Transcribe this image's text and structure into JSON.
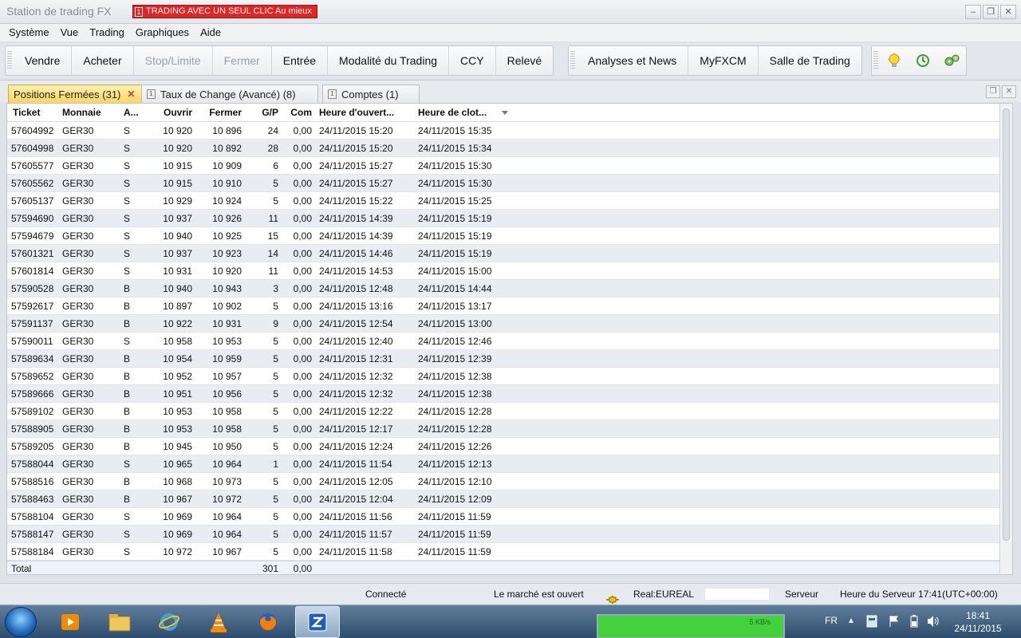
{
  "window": {
    "title": "Station de trading FX",
    "promo_badge": "1",
    "promo_text": "TRADING AVEC UN SEUL CLIC Au mieux"
  },
  "menu": [
    "Système",
    "Vue",
    "Trading",
    "Graphiques",
    "Aide"
  ],
  "toolbar": {
    "group1": [
      {
        "label": "Vendre",
        "enabled": true
      },
      {
        "label": "Acheter",
        "enabled": true
      },
      {
        "label": "Stop/Limite",
        "enabled": false
      },
      {
        "label": "Fermer",
        "enabled": false
      },
      {
        "label": "Entrée",
        "enabled": true
      },
      {
        "label": "Modalité du Trading",
        "enabled": true
      },
      {
        "label": "CCY",
        "enabled": true
      },
      {
        "label": "Relevé",
        "enabled": true
      }
    ],
    "group2": [
      {
        "label": "Analyses et News",
        "enabled": true
      },
      {
        "label": "MyFXCM",
        "enabled": true
      },
      {
        "label": "Salle de Trading",
        "enabled": true
      }
    ],
    "icons": [
      "lightbulb-icon",
      "clock-refresh-icon",
      "gears-icon"
    ]
  },
  "tabs": [
    {
      "label": "Positions Fermées (31)",
      "active": true
    },
    {
      "label": "Taux de Change (Avancé) (8)",
      "active": false,
      "icon_text": "1"
    },
    {
      "label": "Comptes (1)",
      "active": false,
      "icon_text": "1"
    }
  ],
  "table": {
    "columns": [
      "Ticket",
      "Monnaie",
      "A...",
      "Ouvrir",
      "Fermer",
      "G/P",
      "Com",
      "Heure d'ouvert...",
      "Heure de clot..."
    ],
    "rows": [
      [
        "57604992",
        "GER30",
        "S",
        "10 920",
        "10 896",
        "24",
        "0,00",
        "24/11/2015 15:20",
        "24/11/2015 15:35"
      ],
      [
        "57604998",
        "GER30",
        "S",
        "10 920",
        "10 892",
        "28",
        "0,00",
        "24/11/2015 15:20",
        "24/11/2015 15:34"
      ],
      [
        "57605577",
        "GER30",
        "S",
        "10 915",
        "10 909",
        "6",
        "0,00",
        "24/11/2015 15:27",
        "24/11/2015 15:30"
      ],
      [
        "57605562",
        "GER30",
        "S",
        "10 915",
        "10 910",
        "5",
        "0,00",
        "24/11/2015 15:27",
        "24/11/2015 15:30"
      ],
      [
        "57605137",
        "GER30",
        "S",
        "10 929",
        "10 924",
        "5",
        "0,00",
        "24/11/2015 15:22",
        "24/11/2015 15:25"
      ],
      [
        "57594690",
        "GER30",
        "S",
        "10 937",
        "10 926",
        "11",
        "0,00",
        "24/11/2015 14:39",
        "24/11/2015 15:19"
      ],
      [
        "57594679",
        "GER30",
        "S",
        "10 940",
        "10 925",
        "15",
        "0,00",
        "24/11/2015 14:39",
        "24/11/2015 15:19"
      ],
      [
        "57601321",
        "GER30",
        "S",
        "10 937",
        "10 923",
        "14",
        "0,00",
        "24/11/2015 14:46",
        "24/11/2015 15:19"
      ],
      [
        "57601814",
        "GER30",
        "S",
        "10 931",
        "10 920",
        "11",
        "0,00",
        "24/11/2015 14:53",
        "24/11/2015 15:00"
      ],
      [
        "57590528",
        "GER30",
        "B",
        "10 940",
        "10 943",
        "3",
        "0,00",
        "24/11/2015 12:48",
        "24/11/2015 14:44"
      ],
      [
        "57592617",
        "GER30",
        "B",
        "10 897",
        "10 902",
        "5",
        "0,00",
        "24/11/2015 13:16",
        "24/11/2015 13:17"
      ],
      [
        "57591137",
        "GER30",
        "B",
        "10 922",
        "10 931",
        "9",
        "0,00",
        "24/11/2015 12:54",
        "24/11/2015 13:00"
      ],
      [
        "57590011",
        "GER30",
        "S",
        "10 958",
        "10 953",
        "5",
        "0,00",
        "24/11/2015 12:40",
        "24/11/2015 12:46"
      ],
      [
        "57589634",
        "GER30",
        "B",
        "10 954",
        "10 959",
        "5",
        "0,00",
        "24/11/2015 12:31",
        "24/11/2015 12:39"
      ],
      [
        "57589652",
        "GER30",
        "B",
        "10 952",
        "10 957",
        "5",
        "0,00",
        "24/11/2015 12:32",
        "24/11/2015 12:38"
      ],
      [
        "57589666",
        "GER30",
        "B",
        "10 951",
        "10 956",
        "5",
        "0,00",
        "24/11/2015 12:32",
        "24/11/2015 12:38"
      ],
      [
        "57589102",
        "GER30",
        "B",
        "10 953",
        "10 958",
        "5",
        "0,00",
        "24/11/2015 12:22",
        "24/11/2015 12:28"
      ],
      [
        "57588905",
        "GER30",
        "B",
        "10 953",
        "10 958",
        "5",
        "0,00",
        "24/11/2015 12:17",
        "24/11/2015 12:28"
      ],
      [
        "57589205",
        "GER30",
        "B",
        "10 945",
        "10 950",
        "5",
        "0,00",
        "24/11/2015 12:24",
        "24/11/2015 12:26"
      ],
      [
        "57588044",
        "GER30",
        "S",
        "10 965",
        "10 964",
        "1",
        "0,00",
        "24/11/2015 11:54",
        "24/11/2015 12:13"
      ],
      [
        "57588516",
        "GER30",
        "B",
        "10 968",
        "10 973",
        "5",
        "0,00",
        "24/11/2015 12:05",
        "24/11/2015 12:10"
      ],
      [
        "57588463",
        "GER30",
        "B",
        "10 967",
        "10 972",
        "5",
        "0,00",
        "24/11/2015 12:04",
        "24/11/2015 12:09"
      ],
      [
        "57588104",
        "GER30",
        "S",
        "10 969",
        "10 964",
        "5",
        "0,00",
        "24/11/2015 11:56",
        "24/11/2015 11:59"
      ],
      [
        "57588147",
        "GER30",
        "S",
        "10 969",
        "10 964",
        "5",
        "0,00",
        "24/11/2015 11:57",
        "24/11/2015 11:59"
      ],
      [
        "57588184",
        "GER30",
        "S",
        "10 972",
        "10 967",
        "5",
        "0,00",
        "24/11/2015 11:58",
        "24/11/2015 11:59"
      ]
    ],
    "total": {
      "label": "Total",
      "gp": "301",
      "com": "0,00"
    }
  },
  "status": {
    "connection": "Connecté",
    "market": "Le marché est ouvert",
    "account": "Real:EUREAL",
    "server": "Serveur",
    "server_time": "Heure du Serveur 17:41(UTC+00:00)"
  },
  "taskbar": {
    "apps": [
      "media-player-icon",
      "file-explorer-icon",
      "internet-explorer-icon",
      "vlc-icon",
      "firefox-icon",
      "fxcm-app-icon"
    ],
    "net_label": "5 KB/s",
    "language": "FR",
    "time": "18:41",
    "date": "24/11/2015"
  },
  "colors": {
    "active_tab": "#ffd45c",
    "promo_red": "#e02525",
    "row_alt": "#e9ecf1"
  }
}
